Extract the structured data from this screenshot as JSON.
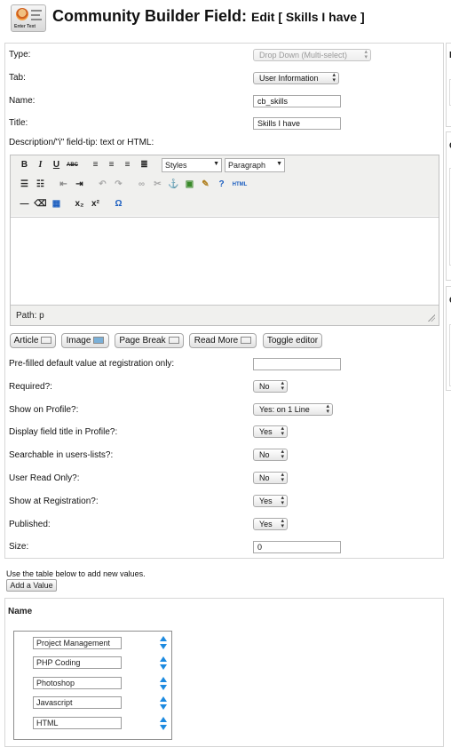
{
  "header": {
    "title": "Community Builder Field:",
    "subtitle": "Edit [ Skills I have ]",
    "icon": "field-editor-icon",
    "icon_caption": "Enter Text"
  },
  "form": {
    "type": {
      "label": "Type:",
      "value": "Drop Down (Multi-select)"
    },
    "tab": {
      "label": "Tab:",
      "value": "User Information"
    },
    "name": {
      "label": "Name:",
      "value": "cb_skills"
    },
    "title": {
      "label": "Title:",
      "value": "Skills I have"
    },
    "description": {
      "label": "Description/\"i\" field-tip: text or HTML:"
    }
  },
  "editor": {
    "styles_label": "Styles",
    "format_label": "Paragraph",
    "html_label": "HTML",
    "path_label": "Path:",
    "path_value": "p",
    "toolbar_row1": [
      "B",
      "I",
      "U",
      "ABC"
    ],
    "buttons": [
      "Article",
      "Image",
      "Page Break",
      "Read More",
      "Toggle editor"
    ]
  },
  "fields": [
    {
      "label": "Pre-filled default value at registration only:",
      "value": "",
      "kind": "text"
    },
    {
      "label": "Required?:",
      "value": "No",
      "kind": "select"
    },
    {
      "label": "Show on Profile?:",
      "value": "Yes: on 1 Line",
      "kind": "select"
    },
    {
      "label": "Display field title in Profile?:",
      "value": "Yes",
      "kind": "select"
    },
    {
      "label": "Searchable in users-lists?:",
      "value": "No",
      "kind": "select"
    },
    {
      "label": "User Read Only?:",
      "value": "No",
      "kind": "select"
    },
    {
      "label": "Show at Registration?:",
      "value": "Yes",
      "kind": "select"
    },
    {
      "label": "Published:",
      "value": "Yes",
      "kind": "select"
    },
    {
      "label": "Size:",
      "value": "0",
      "kind": "text"
    }
  ],
  "values_section": {
    "note": "Use the table below to add new values.",
    "add_button": "Add a Value",
    "column_header": "Name",
    "values": [
      "Project Management",
      "PHP Coding",
      "Photoshop",
      "Javascript",
      "HTML"
    ]
  },
  "colors": {
    "accent_blue": "#1d8ae0",
    "toolbar_bg": "#f0f0ee",
    "panel_border": "#d6d6d6"
  }
}
